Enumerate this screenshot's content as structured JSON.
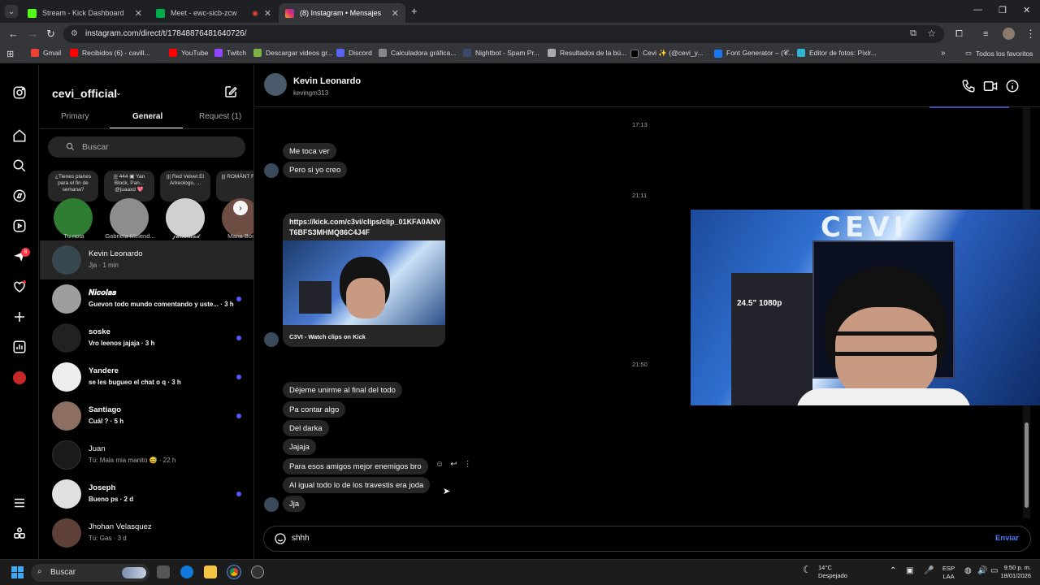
{
  "browser": {
    "tabs": [
      {
        "title": "Stream - Kick Dashboard",
        "favicon_color": "#53fc18"
      },
      {
        "title": "Meet - ewc-sicb-zcw",
        "favicon_color": "#00ac47"
      },
      {
        "title": "(8) Instagram • Mensajes",
        "favicon_color": "#e1306c"
      }
    ],
    "new_tab": "+",
    "url": "instagram.com/direct/t/17848876481640726/",
    "bookmarks": [
      {
        "label": "Gmail",
        "color": "#ea4335"
      },
      {
        "label": "Recibidos (6) - cavill...",
        "color": "#ff0000"
      },
      {
        "label": "YouTube",
        "color": "#ff0000"
      },
      {
        "label": "Twitch",
        "color": "#9146ff"
      },
      {
        "label": "Descargar videos gr...",
        "color": "#7cb342"
      },
      {
        "label": "Discord",
        "color": "#5865f2"
      },
      {
        "label": "Calculadora gráfica...",
        "color": "#888888"
      },
      {
        "label": "Nightbot - Spam Pr...",
        "color": "#3b4a6b"
      },
      {
        "label": "Resultados de la bú...",
        "color": "#aaaaaa"
      },
      {
        "label": "Cevi ✨ (@cevi_y...",
        "color": "#000000"
      },
      {
        "label": "Font Generator – (𝓒...",
        "color": "#1877f2"
      },
      {
        "label": "Editor de fotos: Pixlr...",
        "color": "#2fb5d2"
      }
    ],
    "all_bookmarks": "Todos los favoritos"
  },
  "sidebar": {
    "notification_count": "8"
  },
  "inbox": {
    "account": "cevi_official",
    "tabs": [
      "Primary",
      "General",
      "Request (1)"
    ],
    "active_tab": "General",
    "search_placeholder": "Buscar",
    "notes": [
      {
        "name": "Tu nota",
        "bubble": "¿Tienes planes para el fin de semana?",
        "color": "#2e7d32"
      },
      {
        "name": "Gabriela Melend...",
        "bubble": "||| 444 ▣ Yan Block, Pan... @juaaxd 💖",
        "color": "#8d8d8d"
      },
      {
        "name": "𝓳𝓾𝓵𝓲𝓮𝓽𝓪𝓪𝓭",
        "bubble": "||| Red Velvet El Arkeologo, ...",
        "color": "#d0d0d0"
      },
      {
        "name": "Maria Boni",
        "bubble": "||| ROMÁNT Feid",
        "color": "#6d4c41"
      }
    ],
    "conversations": [
      {
        "name": "Kevin Leonardo",
        "preview": "Jja · 1 min",
        "unread": false,
        "selected": true,
        "color": "#37474f"
      },
      {
        "name": "𝑵𝒊𝒄𝒐𝒍𝒂𝒔",
        "preview": "Guevon todo mundo comentando y uste... · 3 h",
        "unread": true,
        "selected": false,
        "color": "#9e9e9e"
      },
      {
        "name": "soske",
        "preview": "Vro leenos jajaja · 3 h",
        "unread": true,
        "selected": false,
        "color": "#212121"
      },
      {
        "name": "Yandere",
        "preview": "se les bugueo el chat o q · 3 h",
        "unread": true,
        "selected": false,
        "color": "#eeeeee"
      },
      {
        "name": "Santiago",
        "preview": "Cuál ? · 5 h",
        "unread": true,
        "selected": false,
        "color": "#8d6e63"
      },
      {
        "name": "Juan",
        "preview": "Tú: Mala mia manito 😅 · 22 h",
        "unread": false,
        "selected": false,
        "color": "#1a1a1a"
      },
      {
        "name": "Joseph",
        "preview": "Bueno ps · 2 d",
        "unread": true,
        "selected": false,
        "color": "#e0e0e0"
      },
      {
        "name": "Jhohan Velasquez",
        "preview": "Tú: Gas · 3 d",
        "unread": false,
        "selected": false,
        "color": "#5d4037"
      }
    ]
  },
  "chat": {
    "name": "Kevin Leonardo",
    "username": "kevingm313",
    "timestamps": [
      "17:13",
      "21:11",
      "21:50"
    ],
    "messages_a": [
      "Me toca ver",
      "Pero si yo creo"
    ],
    "link": {
      "url": "https://kick.com/c3vi/clips/clip_01KFA0ANVT6BFS3MHMQ86C4J4F",
      "title": "C3VI - Watch clips on Kick"
    },
    "messages_b": [
      "Déjeme unirme al final del todo",
      "Pa contar algo",
      "Del darka",
      "Jajaja",
      "Para esos amigos mejor enemigos bro",
      "Al igual todo lo de los travestis era joda",
      "Jja"
    ],
    "draft": "shhh",
    "send_label": "Enviar"
  },
  "video_overlay": {
    "logo": "CEVI",
    "monitor_label": "24.5\" 1080p"
  },
  "taskbar": {
    "search": "Buscar",
    "weather_temp": "14°C",
    "weather_desc": "Despejado",
    "lang": "ESP",
    "lang2": "LAA",
    "time": "9:50 p. m.",
    "date": "18/01/2026"
  }
}
